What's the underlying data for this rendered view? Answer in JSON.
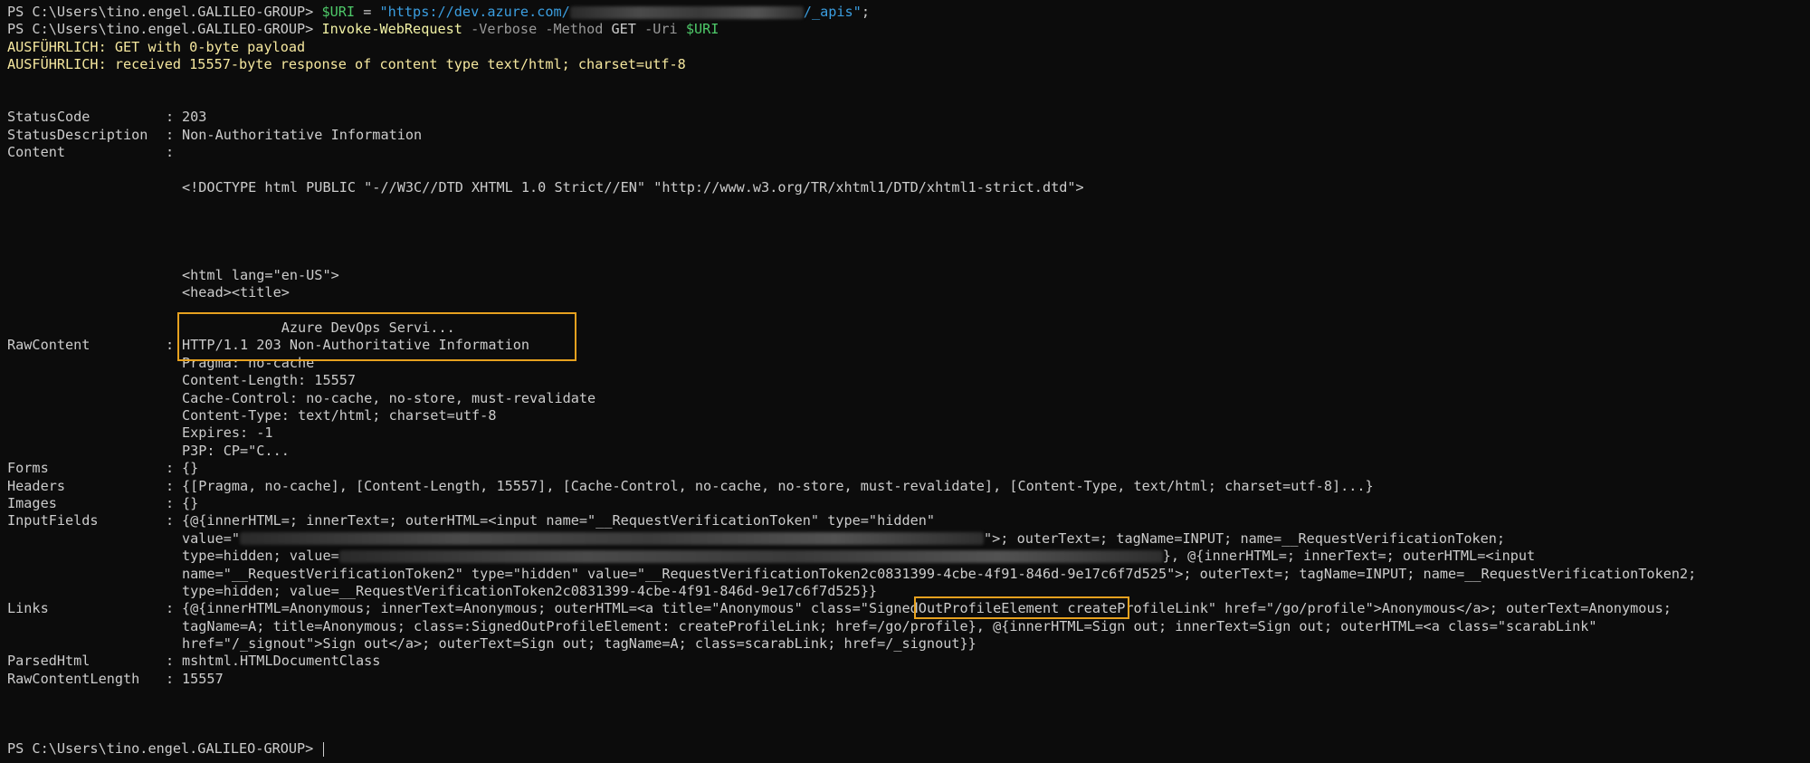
{
  "prompt": "PS C:\\Users\\tino.engel.GALILEO-GROUP> ",
  "line1": {
    "var": "$URI",
    "eq": " = ",
    "str_start": "\"https://dev.azure.com/",
    "str_end": "/_apis\"",
    "end": ";"
  },
  "line2": {
    "cmd": "Invoke-WebRequest",
    "p1": " -Verbose",
    "p2": " -Method",
    "v2": " GET",
    "p3": " -Uri",
    "v3": " $URI"
  },
  "verbose": [
    "AUSFÜHRLICH: GET with 0-byte payload",
    "AUSFÜHRLICH: received 15557-byte response of content type text/html; charset=utf-8"
  ],
  "status_code": {
    "key": "StatusCode",
    "value": "203"
  },
  "status_description": {
    "key": "StatusDescription",
    "value": "Non-Authoritative Information"
  },
  "content": {
    "key": "Content",
    "doctype": "<!DOCTYPE html PUBLIC \"-//W3C//DTD XHTML 1.0 Strict//EN\" \"http://www.w3.org/TR/xhtml1/DTD/xhtml1-strict.dtd\">",
    "html_open": "<html lang=\"en-US\">",
    "head": "<head><title>",
    "title": "            Azure DevOps Servi..."
  },
  "raw_content": {
    "key": "RawContent",
    "lines": [
      "HTTP/1.1 203 Non-Authoritative Information",
      "Pragma: no-cache",
      "Content-Length: 15557",
      "Cache-Control: no-cache, no-store, must-revalidate",
      "Content-Type: text/html; charset=utf-8",
      "Expires: -1",
      "P3P: CP=\"C..."
    ]
  },
  "forms": {
    "key": "Forms",
    "value": "{}"
  },
  "headers": {
    "key": "Headers",
    "value": "{[Pragma, no-cache], [Content-Length, 15557], [Cache-Control, no-cache, no-store, must-revalidate], [Content-Type, text/html; charset=utf-8]...}"
  },
  "images": {
    "key": "Images",
    "value": "{}"
  },
  "input_fields": {
    "key": "InputFields",
    "l1": "{@{innerHTML=; innerText=; outerHTML=<input name=\"__RequestVerificationToken\" type=\"hidden\"",
    "l2a": "value=\"",
    "l2b": "\">; outerText=; tagName=INPUT; name=__RequestVerificationToken;",
    "l3a": "type=hidden; value=",
    "l3b": "}, @{innerHTML=; innerText=; outerHTML=<input",
    "l4": "name=\"__RequestVerificationToken2\" type=\"hidden\" value=\"__RequestVerificationToken2c0831399-4cbe-4f91-846d-9e17c6f7d525\">; outerText=; tagName=INPUT; name=__RequestVerificationToken2;",
    "l5": "type=hidden; value=__RequestVerificationToken2c0831399-4cbe-4f91-846d-9e17c6f7d525}}"
  },
  "links": {
    "key": "Links",
    "l1a": "{@{innerHTML=Anonymous; innerText=Anonymous; outerHTML=<a title=\"Anonymous\" class=\"",
    "l1b": "SignedOutProfileElement",
    "l1c": " createProfileLink\" href=\"/go/profile\">Anonymous</a>; outerText=Anonymous;",
    "l2": "tagName=A; title=Anonymous; class=:SignedOutProfileElement: createProfileLink; href=/go/profile}, @{innerHTML=Sign out; innerText=Sign out; outerHTML=<a class=\"scarabLink\"",
    "l3": "href=\"/_signout\">Sign out</a>; outerText=Sign out; tagName=A; class=scarabLink; href=/_signout}}"
  },
  "parsed_html": {
    "key": "ParsedHtml",
    "value": "mshtml.HTMLDocumentClass"
  },
  "raw_content_length": {
    "key": "RawContentLength",
    "value": "15557"
  },
  "colon": ":"
}
